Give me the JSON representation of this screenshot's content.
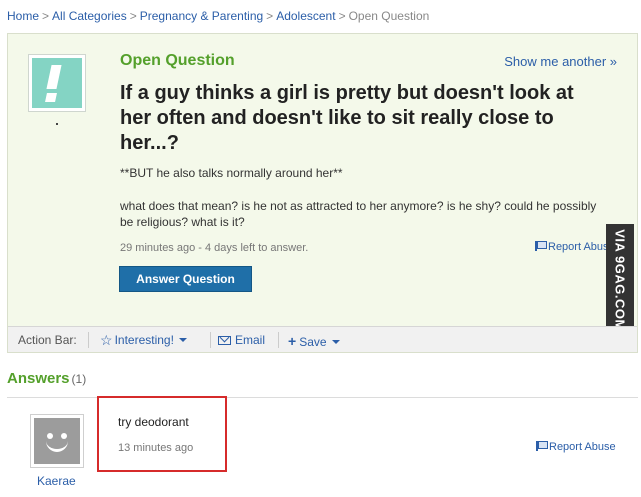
{
  "breadcrumb": {
    "items": [
      "Home",
      "All Categories",
      "Pregnancy & Parenting",
      "Adolescent"
    ],
    "current": "Open Question",
    "separator": ">"
  },
  "question": {
    "status": "Open Question",
    "show_another": "Show me another »",
    "title": "If a guy thinks a girl is pretty but doesn't look at her often and doesn't like to sit really close to her...?",
    "detail_line1": "**BUT he also talks normally around her**",
    "detail_line2": "what does that mean? is he not as attracted to her anymore? is he shy? could he possibly be religious? what is it?",
    "meta": "29 minutes ago - 4 days left to answer.",
    "report": "Report Abuse",
    "answer_button": "Answer Question"
  },
  "watermark": "VIA 9GAG.COM",
  "action_bar": {
    "label": "Action Bar:",
    "interesting": "Interesting!",
    "email": "Email",
    "save": "Save"
  },
  "answers": {
    "heading": "Answers",
    "count": "(1)",
    "items": [
      {
        "text": "try deodorant",
        "time": "13 minutes ago",
        "user": "Kaerae",
        "report": "Report Abuse"
      }
    ]
  },
  "colors": {
    "link": "#2b5ea8",
    "green": "#54a02b",
    "button": "#1f6fa8",
    "highlight": "#d62b2b"
  }
}
